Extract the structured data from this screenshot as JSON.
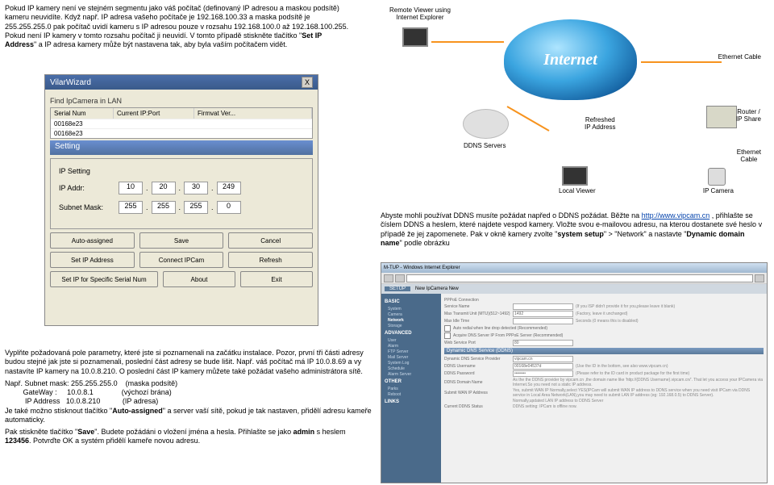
{
  "intro": "Pokud IP kamery není ve stejném segmentu jako váš počítač (definovaný IP adresou a maskou podsítě) kameru neuvidíte. Když např. IP adresa vašeho počítače je 192.168.100.33 a maska podsítě je 255.255.255.0 pak počítač uvidí kameru s IP adresou pouze v rozsahu 192.168.100.0 až 192.168.100.255. Pokud není IP kamery v tomto rozsahu počítač ji neuvidí. V tomto případě stiskněte tlačítko \"",
  "intro_bold": "Set IP Address",
  "intro_tail": "\" a IP adresa kamery může být nastavena tak, aby byla vaším počítačem vidět.",
  "wizard": {
    "title": "VilarWizard",
    "close": "X",
    "find_label": "Find IpCamera in LAN",
    "cols": {
      "sn": "Serial Num",
      "ip": "Current IP:Port",
      "fw": "Firmvat Ver..."
    },
    "rows": [
      {
        "sn": "00168e23",
        "ip": "",
        "fw": ""
      },
      {
        "sn": "00168e23",
        "ip": "",
        "fw": ""
      }
    ],
    "setting": "Setting",
    "ip_setting": "IP Setting",
    "ip_label": "IP Addr:",
    "ip": [
      "10",
      "20",
      "30",
      "249"
    ],
    "mask_label": "Subnet Mask:",
    "mask": [
      "255",
      "255",
      "255",
      "0"
    ],
    "btns1": {
      "auto": "Auto-assigned",
      "save": "Save",
      "cancel": "Cancel"
    },
    "btns2": {
      "set": "Set IP Address",
      "connect": "Connect IPCam",
      "refresh": "Refresh"
    },
    "btns3": {
      "spec": "Set IP for Specific Serial Num",
      "about": "About",
      "exit": "Exit"
    }
  },
  "diagram": {
    "remote": "Remote Viewer using\nInternet Explorer",
    "internet": "Internet",
    "ethernet_cable": "Ethernet Cable",
    "ddns": "DDNS Servers",
    "router": "Router /\nIP Share",
    "refreshed": "Refreshed\nIP Address",
    "eth2": "Ethernet\nCable",
    "local": "Local Viewer",
    "ipcam": "IP Camera"
  },
  "right_para": {
    "p1": "Abyste mohli používat DDNS musíte požádat napřed o DDNS požádat. Běžte na ",
    "link": "http://www.vipcam.cn",
    "p2": " , přihlašte se číslem DDNS a heslem, které najdete vespod kamery. Vložte svou e-mailovou adresu, na kterou dostanete své heslo v případě že jej zapomenete. Pak v okně kamery zvolte \"",
    "b1": "system setup",
    "p3": "\"  > \"Network\" a nastavte \"",
    "b2": "Dynamic domain name",
    "p4": "\" podle obrázku"
  },
  "ie": {
    "title": "M-TUP - Windows Internet Explorer",
    "tabs": {
      "setup": "SETUP"
    },
    "nav": {
      "newcam": "New IpCamera New"
    },
    "sidebar": {
      "basic": "BASIC",
      "basic_items": [
        "System",
        "Camera",
        "Network",
        "Storage"
      ],
      "advanced": "ADVANCED",
      "adv_items": [
        "User",
        "Alarm",
        "FTP Server",
        "Mail Server",
        "System Log",
        "Schedule",
        "Alarm Server"
      ],
      "other": "OTHER",
      "other_items": [
        "Parks",
        "Reboot"
      ],
      "links": "LINKS"
    },
    "main": {
      "pppoe_sec": "PPPoE Connection",
      "pppoe_conn": "PPPoE Connection",
      "svc_name": "Service Name",
      "svc_hint": "(If you ISP didn't provide it for you,please leave it blank)",
      "mtu": "Max Transmit Unit (MTU)(512~1492)",
      "mtu_val": "1492",
      "mtu_hint": "(Factory, leave it unchanged)",
      "idle": "Max Idle Time",
      "idle_hint": "Seconds (0 means this is disabled)",
      "auto_redial": "Auto redial when line drop detected (Recommended)",
      "acquire_dns": "Acquire DNS Server IP From PPPoE Server (Recommended)",
      "wsp": "Web Service Port",
      "wsp_val": "80",
      "ddns_sec": "Dynamic DNS Service (DDNS)",
      "provider": "Dynamic DNS Service Provider",
      "provider_val": "vipcam.cn",
      "ddns_user": "DDNS Username",
      "user_val": "00168e04537d",
      "user_hint": "(Use the ID in the bottom, see also www.vipcam.cn)",
      "ddns_pass": "DDNS Password",
      "pass_val": "••••••••",
      "pass_hint": "(Please refer to the ID card in product package for the first time)",
      "ddns_domain": "DDNS Domain Name",
      "domain_hint": "As the the DDNS provider by vipcam.cn ,the domain name like 'http://{DDNS Username}.vipcam.cn/'. That let you access your IPCamera via Internet.So you need not a static IP address.",
      "submit_wan": "Submit WAN IP Address",
      "wan_hint": "Yes, submit WAN IP  Normally,select YES(IPCam will submit WAN IP address to DDNS service when you need visit IPCam via DDNS service in Local Area Network(LAN),you may need to submit LAN IP address (eg: 192.168.0.5) to DDNS Server).",
      "wan_hint2": "Normally,updated LAN IP address to DDNS Server",
      "status": "Current DDNS Status",
      "status_val": "DDNS setting: IPCam is offline now."
    }
  },
  "bottom": {
    "p1": "Vyplňte požadovaná pole parametry, které jste si poznamenali na začátku instalace. Pozor, první tři části adresy budou stejné jak jste si poznamenali, poslední část adresy se bude lišit. Např. váš počítač má IP 10.0.8.69 a vy nastavíte IP kamery na 10.0.8.210. O poslední část IP kamery můžete také požádat vašeho administrátora sítě.",
    "l1": "Např. Subnet mask: 255.255.255.0    (maska podsítě)",
    "l2": "         GateWay :     10.0.8.1              (výchozí brána)",
    "l3": "          IP Address   10.0.8.210           (IP adresa)",
    "p2a": "Je také možno stisknout tlačítko \"",
    "p2b": "Auto-assigned",
    "p2c": "\" a server vaší sítě, pokud je tak nastaven, přidělí adresu kameře automaticky.",
    "p3a": "Pak stiskněte tlačítko \"",
    "p3b": "Save",
    "p3c": "\". Budete požádáni o vložení jména a hesla. Přihlašte se jako ",
    "p3d": "admin",
    "p3e": " s heslem ",
    "p3f": "123456",
    "p3g": ". Potvrďte OK a systém přidělí kameře novou adresu."
  }
}
